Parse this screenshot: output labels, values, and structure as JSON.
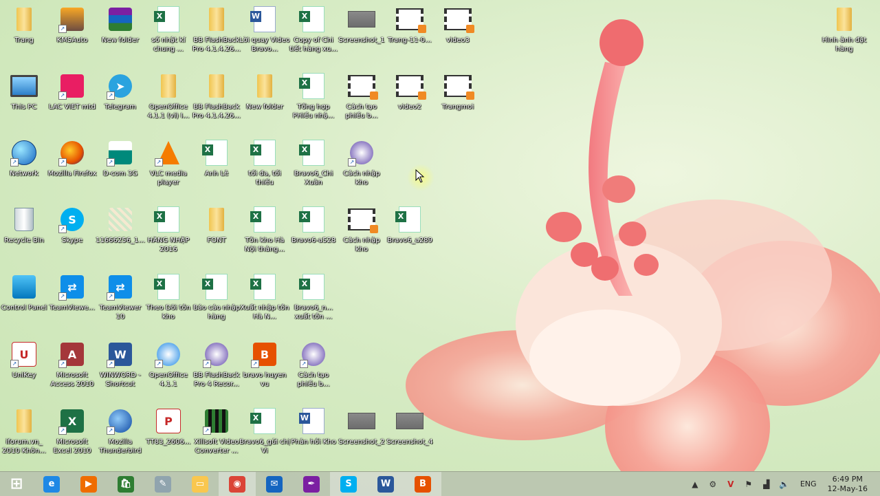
{
  "desktop": {
    "icons": [
      {
        "label": "Trang",
        "icon": "folder-user-icon"
      },
      {
        "label": "KMSAuto",
        "icon": "kmsauto-icon"
      },
      {
        "label": "New folder",
        "icon": "winrar-icon"
      },
      {
        "label": "số nhật kí chung ...",
        "icon": "excel-file-icon"
      },
      {
        "label": "BB FlashBack Pro 4.1.4.26...",
        "icon": "folder-icon"
      },
      {
        "label": "Lời quay Video Bravo...",
        "icon": "word-file-icon"
      },
      {
        "label": "Copy of Chi tiết hàng xu...",
        "icon": "excel-file-icon"
      },
      {
        "label": "Screenshot_1",
        "icon": "screenshot-icon"
      },
      {
        "label": "Trang-11-0...",
        "icon": "video-file-icon"
      },
      {
        "label": "video3",
        "icon": "video-file-icon"
      },
      {
        "label": "Hình ảnh đặt hàng",
        "icon": "folder-icon"
      },
      {
        "label": "This PC",
        "icon": "computer-icon"
      },
      {
        "label": "LAC VIET mtd",
        "icon": "lacviet-icon"
      },
      {
        "label": "Telegram",
        "icon": "telegram-icon"
      },
      {
        "label": "OpenOffice 4.1.1 (vi) I...",
        "icon": "folder-icon"
      },
      {
        "label": "BB FlashBack Pro 4.1.4.26...",
        "icon": "folder-icon"
      },
      {
        "label": "New folder",
        "icon": "folder-icon"
      },
      {
        "label": "Tổng hợp PHiếu nhậ...",
        "icon": "excel-file-icon"
      },
      {
        "label": "Cách tạo phiếu b...",
        "icon": "video-file-icon"
      },
      {
        "label": "video2",
        "icon": "video-file-icon"
      },
      {
        "label": "Trangmoi",
        "icon": "video-file-icon"
      },
      {
        "label": "Network",
        "icon": "network-icon"
      },
      {
        "label": "Mozilla Firefox",
        "icon": "firefox-icon"
      },
      {
        "label": "D-com 3G",
        "icon": "viettel-icon"
      },
      {
        "label": "VLC media player",
        "icon": "vlc-icon"
      },
      {
        "label": "Anh Lê",
        "icon": "excel-file-icon"
      },
      {
        "label": "tối đa, tối thiểu",
        "icon": "excel-file-icon"
      },
      {
        "label": "Bravo6_Chi Xuân",
        "icon": "excel-file-icon"
      },
      {
        "label": "Cách nhập kho",
        "icon": "flashback-player-icon"
      },
      {
        "label": "Recycle Bin",
        "icon": "recycle-bin-icon"
      },
      {
        "label": "Skype",
        "icon": "skype-icon"
      },
      {
        "label": "11666256_1...",
        "icon": "image-file-icon"
      },
      {
        "label": "HÀNG NHẬP 2016",
        "icon": "excel-file-icon"
      },
      {
        "label": "FONT",
        "icon": "folder-icon"
      },
      {
        "label": "Tồn kho Hà Nội tháng...",
        "icon": "excel-file-icon"
      },
      {
        "label": "Bravo6-a528",
        "icon": "excel-file-icon"
      },
      {
        "label": "Cách nhập kho",
        "icon": "video-file-icon"
      },
      {
        "label": "Bravo6_a289",
        "icon": "excel-file-icon"
      },
      {
        "label": "Control Panel",
        "icon": "control-panel-icon"
      },
      {
        "label": "TeamViewe...",
        "icon": "teamviewer-icon"
      },
      {
        "label": "TeamViewer 10",
        "icon": "teamviewer-icon"
      },
      {
        "label": "Theo Dõi tồn kho",
        "icon": "excel-file-icon"
      },
      {
        "label": "Báo cáo nhập hàng",
        "icon": "excel-file-icon"
      },
      {
        "label": "Xuất nhập tồn Hà N...",
        "icon": "excel-file-icon"
      },
      {
        "label": "Bravo6_n... xuất tồn ...",
        "icon": "excel-file-icon"
      },
      {
        "label": "UniKey",
        "icon": "unikey-icon"
      },
      {
        "label": "Microsoft Access 2010",
        "icon": "access-icon"
      },
      {
        "label": "WINWORD - Shortcut",
        "icon": "word-icon"
      },
      {
        "label": "OpenOffice 4.1.1",
        "icon": "openoffice-icon"
      },
      {
        "label": "BB FlashBack Pro 4 Recor...",
        "icon": "flashback-recorder-icon"
      },
      {
        "label": "bravo huyen vu",
        "icon": "bravo-icon"
      },
      {
        "label": "Cách tạo phiếu b...",
        "icon": "flashback-player-icon"
      },
      {
        "label": "iforum.vn_ 2010 Khôn...",
        "icon": "folder-icon"
      },
      {
        "label": "Microsoft Excel 2010",
        "icon": "excel-icon"
      },
      {
        "label": "Mozilla Thunderbird",
        "icon": "thunderbird-icon"
      },
      {
        "label": "TT83_2606...",
        "icon": "pdf-file-icon"
      },
      {
        "label": "Xilisoft Video Converter ...",
        "icon": "xilisoft-icon"
      },
      {
        "label": "Bravo6_gửi chị Vi",
        "icon": "excel-file-icon"
      },
      {
        "label": "Phản hồi Kho",
        "icon": "word-file-icon"
      },
      {
        "label": "Screenshot_2",
        "icon": "screenshot-icon"
      },
      {
        "label": "Screenshot_4",
        "icon": "screenshot-icon"
      }
    ]
  },
  "taskbar": {
    "buttons": [
      {
        "name": "start-button",
        "icon": "windows-logo-icon",
        "color": "#ffffff"
      },
      {
        "name": "taskbar-internet-explorer",
        "icon": "internet-explorer-icon",
        "color": "#1e88e5"
      },
      {
        "name": "taskbar-media",
        "icon": "media-player-icon",
        "color": "#ef6c00"
      },
      {
        "name": "taskbar-store",
        "icon": "store-icon",
        "color": "#2e7d32"
      },
      {
        "name": "taskbar-paint",
        "icon": "paint-icon",
        "color": "#90a4ae"
      },
      {
        "name": "taskbar-file-explorer",
        "icon": "folder-icon",
        "color": "#f9c74f"
      },
      {
        "name": "taskbar-chrome",
        "icon": "chrome-icon",
        "color": "#db4437"
      },
      {
        "name": "taskbar-thunderbird",
        "icon": "thunderbird-icon",
        "color": "#1565c0"
      },
      {
        "name": "taskbar-feather",
        "icon": "feather-icon",
        "color": "#7b1fa2"
      },
      {
        "name": "taskbar-skype",
        "icon": "skype-icon",
        "color": "#00aff0"
      },
      {
        "name": "taskbar-word",
        "icon": "word-icon",
        "color": "#2b579a"
      },
      {
        "name": "taskbar-bravo",
        "icon": "bravo-icon",
        "color": "#e65100"
      }
    ],
    "tray": {
      "language": "ENG",
      "time": "6:49 PM",
      "date": "12-May-16"
    }
  }
}
